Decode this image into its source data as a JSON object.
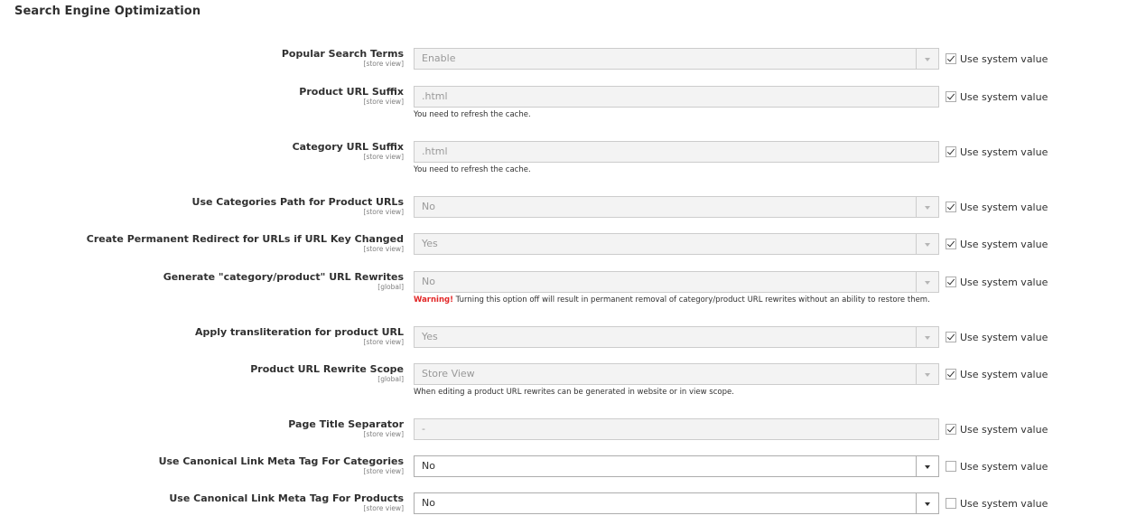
{
  "section": {
    "title": "Search Engine Optimization"
  },
  "use_system_value_label": "Use system value",
  "fields": [
    {
      "label": "Popular Search Terms",
      "scope": "[store view]",
      "type": "select",
      "value": "Enable",
      "disabled": true,
      "use_system": true,
      "note": ""
    },
    {
      "label": "Product URL Suffix",
      "scope": "[store view]",
      "type": "text",
      "value": ".html",
      "disabled": true,
      "use_system": true,
      "note": "You need to refresh the cache."
    },
    {
      "label": "Category URL Suffix",
      "scope": "[store view]",
      "type": "text",
      "value": ".html",
      "disabled": true,
      "use_system": true,
      "note": "You need to refresh the cache."
    },
    {
      "label": "Use Categories Path for Product URLs",
      "scope": "[store view]",
      "type": "select",
      "value": "No",
      "disabled": true,
      "use_system": true,
      "note": ""
    },
    {
      "label": "Create Permanent Redirect for URLs if URL Key Changed",
      "scope": "[store view]",
      "type": "select",
      "value": "Yes",
      "disabled": true,
      "use_system": true,
      "note": ""
    },
    {
      "label": "Generate \"category/product\" URL Rewrites",
      "scope": "[global]",
      "type": "select",
      "value": "No",
      "disabled": true,
      "use_system": true,
      "note_warning": "Warning!",
      "note": " Turning this option off will result in permanent removal of category/product URL rewrites without an ability to restore them."
    },
    {
      "label": "Apply transliteration for product URL",
      "scope": "[store view]",
      "type": "select",
      "value": "Yes",
      "disabled": true,
      "use_system": true,
      "note": ""
    },
    {
      "label": "Product URL Rewrite Scope",
      "scope": "[global]",
      "type": "select",
      "value": "Store View",
      "disabled": true,
      "use_system": true,
      "note": "When editing a product URL rewrites can be generated in website or in view scope."
    },
    {
      "label": "Page Title Separator",
      "scope": "[store view]",
      "type": "text",
      "value": "-",
      "disabled": true,
      "use_system": true,
      "note": ""
    },
    {
      "label": "Use Canonical Link Meta Tag For Categories",
      "scope": "[store view]",
      "type": "select",
      "value": "No",
      "disabled": false,
      "use_system": false,
      "note": ""
    },
    {
      "label": "Use Canonical Link Meta Tag For Products",
      "scope": "[store view]",
      "type": "select",
      "value": "No",
      "disabled": false,
      "use_system": false,
      "note": ""
    }
  ]
}
